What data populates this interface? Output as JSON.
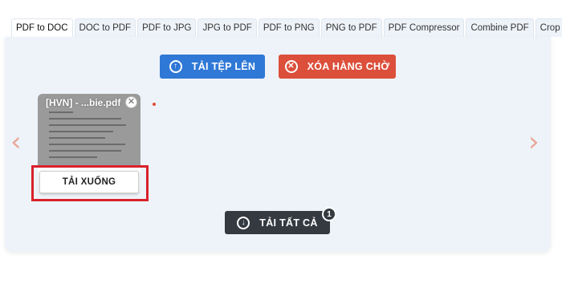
{
  "tabs": [
    {
      "label": "PDF to DOC",
      "active": true
    },
    {
      "label": "DOC to PDF"
    },
    {
      "label": "PDF to JPG"
    },
    {
      "label": "JPG to PDF"
    },
    {
      "label": "PDF to PNG"
    },
    {
      "label": "PNG to PDF"
    },
    {
      "label": "PDF Compressor"
    },
    {
      "label": "Combine PDF"
    },
    {
      "label": "Crop PDF"
    }
  ],
  "actions": {
    "upload_label": "TẢI TỆP LÊN",
    "clear_label": "XÓA HÀNG CHỜ",
    "download_all_label": "TẢI TẤT CẢ",
    "download_all_count": "1"
  },
  "file_card": {
    "filename": "[HVN] - ...bie.pdf",
    "download_label": "TẢI XUỐNG"
  },
  "colors": {
    "upload": "#2f78d6",
    "clear": "#dc4f3b",
    "download_all": "#343a40",
    "highlight": "#d9212b"
  }
}
